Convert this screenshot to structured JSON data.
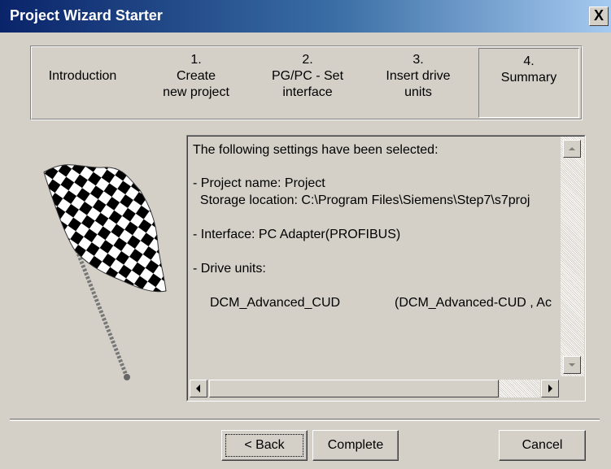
{
  "window": {
    "title": "Project Wizard Starter",
    "close_glyph": "X"
  },
  "steps": [
    {
      "num": "",
      "label": "Introduction"
    },
    {
      "num": "1.",
      "label": "Create\nnew project"
    },
    {
      "num": "2.",
      "label": "PG/PC - Set\ninterface"
    },
    {
      "num": "3.",
      "label": "Insert drive\nunits"
    },
    {
      "num": "4.",
      "label": "Summary",
      "active": true
    }
  ],
  "summary": {
    "lines": [
      "The following settings have been selected:",
      "- Project name: Project",
      "  Storage location: C:\\Program Files\\Siemens\\Step7\\s7proj",
      "- Interface: PC Adapter(PROFIBUS)",
      "- Drive units:",
      "DCM_Advanced_CUD",
      "(DCM_Advanced-CUD , Ac"
    ]
  },
  "buttons": {
    "back": "< Back",
    "complete": "Complete",
    "cancel": "Cancel"
  },
  "icons": {
    "flag": "checkered-flag-icon",
    "scroll_up": "arrow-up-icon",
    "scroll_down": "arrow-down-icon",
    "scroll_left": "arrow-left-icon",
    "scroll_right": "arrow-right-icon"
  }
}
